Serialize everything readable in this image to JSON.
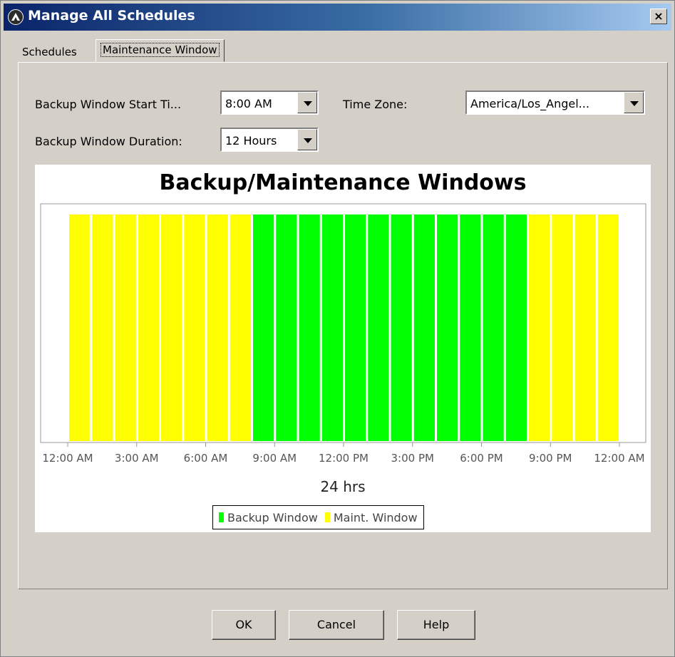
{
  "window": {
    "title": "Manage All Schedules",
    "close_glyph": "×",
    "app_icon": "app-logo-icon"
  },
  "tabs": [
    {
      "label": "Schedules",
      "active": false
    },
    {
      "label": "Maintenance Window",
      "active": true
    }
  ],
  "form": {
    "start_time_label": "Backup Window Start Ti...",
    "start_time_value": "8:00 AM",
    "timezone_label": "Time Zone:",
    "timezone_value": "America/Los_Angel...",
    "duration_label": "Backup Window Duration:",
    "duration_value": "12 Hours"
  },
  "chart_data": {
    "type": "bar",
    "title": "Backup/Maintenance Windows",
    "xlabel": "24 hrs",
    "x_ticks": [
      "12:00 AM",
      "3:00 AM",
      "6:00 AM",
      "9:00 AM",
      "12:00 PM",
      "3:00 PM",
      "6:00 PM",
      "9:00 PM",
      "12:00 AM"
    ],
    "hours": [
      0,
      1,
      2,
      3,
      4,
      5,
      6,
      7,
      8,
      9,
      10,
      11,
      12,
      13,
      14,
      15,
      16,
      17,
      18,
      19,
      20,
      21,
      22,
      23
    ],
    "series": [
      {
        "name": "Backup Window",
        "color": "#00ff00",
        "hours": [
          8,
          9,
          10,
          11,
          12,
          13,
          14,
          15,
          16,
          17,
          18,
          19
        ]
      },
      {
        "name": "Maint. Window",
        "color": "#ffff00",
        "hours": [
          0,
          1,
          2,
          3,
          4,
          5,
          6,
          7,
          20,
          21,
          22,
          23
        ]
      }
    ],
    "legend": [
      "Backup Window",
      "Maint. Window"
    ],
    "legend_position": "bottom-center",
    "grid": false
  },
  "buttons": {
    "ok": "OK",
    "cancel": "Cancel",
    "help": "Help"
  }
}
